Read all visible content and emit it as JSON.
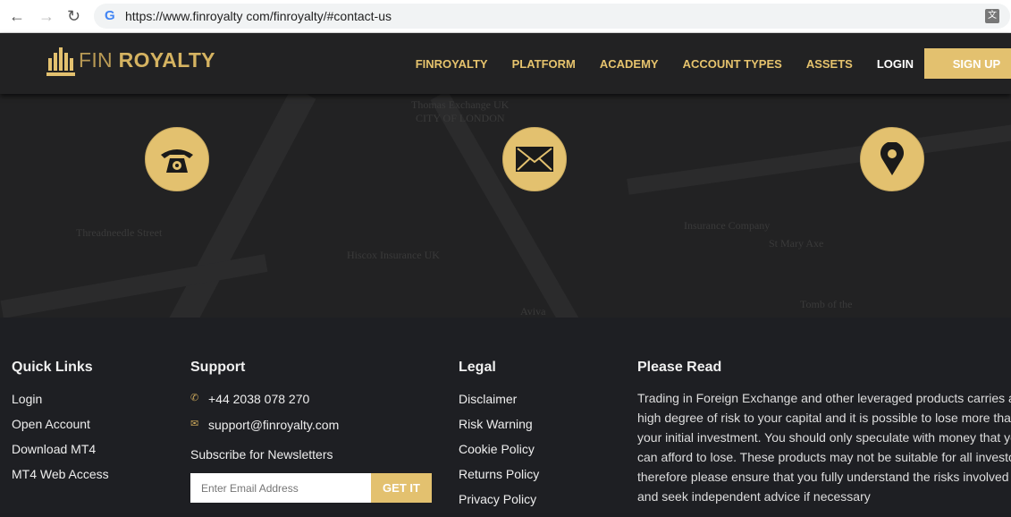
{
  "browser": {
    "url": "https://www.finroyalty com/finroyalty/#contact-us"
  },
  "header": {
    "logo_thin": "FIN",
    "logo_bold": "ROYALTY",
    "menu": [
      "FINROYALTY",
      "PLATFORM",
      "ACADEMY",
      "ACCOUNT TYPES",
      "ASSETS"
    ],
    "login": "LOGIN",
    "signup": "SIGN UP"
  },
  "map": {
    "labels": [
      "Threadneedle Street",
      "Thomas Exchange UK",
      "CITY OF LONDON",
      "Insurance Company",
      "St Mary Axe",
      "Hiscox Insurance UK",
      "Aviva",
      "Tomb of the"
    ],
    "icons": [
      "phone-icon",
      "envelope-icon",
      "map-pin-icon"
    ]
  },
  "footer": {
    "quick_links": {
      "title": "Quick Links",
      "items": [
        "Login",
        "Open Account",
        "Download MT4",
        "MT4 Web Access"
      ]
    },
    "support": {
      "title": "Support",
      "phone": "+44 2038 078 270",
      "email": "support@finroyalty.com",
      "subscribe_label": "Subscribe for Newsletters",
      "email_placeholder": "Enter Email Address",
      "button": "GET IT"
    },
    "legal": {
      "title": "Legal",
      "items": [
        "Disclaimer",
        "Risk Warning",
        "Cookie Policy",
        "Returns Policy",
        "Privacy Policy"
      ]
    },
    "please_read": {
      "title": "Please Read",
      "lines": [
        "Trading in Foreign Exchange and other leveraged products carries a",
        "high degree of risk to your capital and it is possible to lose more than",
        "your initial investment. You should only speculate with money that you",
        "can afford to lose. These products may not be suitable for all investors,",
        "therefore please ensure that you fully understand the risks involved",
        "and seek independent advice if necessary"
      ]
    }
  },
  "colors": {
    "accent": "#e3c16f",
    "header_bg": "#222223",
    "footer_bg": "#1e1f23"
  }
}
